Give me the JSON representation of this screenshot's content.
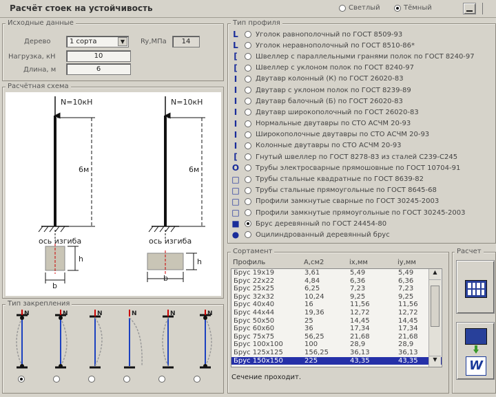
{
  "window": {
    "title": "Расчёт стоек на устойчивость"
  },
  "theme": {
    "options": [
      "Светлый",
      "Тёмный"
    ],
    "selected": "Тёмный"
  },
  "source": {
    "legend": "Исходные данные",
    "wood_label": "Дерево",
    "wood_value": "1 сорта",
    "ru_label": "Ry,МПа",
    "ru_value": "14",
    "load_label": "Нагрузка, кН",
    "load_value": "10",
    "length_label": "Длина, м",
    "length_value": "6"
  },
  "scheme": {
    "legend": "Расчётная схема",
    "force": "N=10кН",
    "length": "6м",
    "axis": "ось изгиба",
    "h": "h",
    "b": "b"
  },
  "fixing": {
    "legend": "Тип закрепления",
    "n": "N",
    "count": 6,
    "selected_index": 0
  },
  "profiles": {
    "legend": "Тип профиля",
    "selected_index": 18,
    "items": [
      {
        "icon": "L",
        "label": "Уголок равнополочный по ГОСТ 8509-93"
      },
      {
        "icon": "L",
        "label": "Уголок неравнополочный по ГОСТ 8510-86*"
      },
      {
        "icon": "[",
        "label": "Швеллер с параллельными гранями полок по ГОСТ 8240-97"
      },
      {
        "icon": "[",
        "label": "Швеллер с уклоном полок по ГОСТ 8240-97"
      },
      {
        "icon": "I",
        "label": "Двутавр колонный (К) по ГОСТ 26020-83"
      },
      {
        "icon": "I",
        "label": "Двутавр с уклоном полок по ГОСТ 8239-89"
      },
      {
        "icon": "I",
        "label": "Двутавр балочный (Б) по ГОСТ 26020-83"
      },
      {
        "icon": "I",
        "label": "Двутавр широкополочный по ГОСТ 26020-83"
      },
      {
        "icon": "I",
        "label": "Нормальные двутавры по СТО АСЧМ 20-93"
      },
      {
        "icon": "I",
        "label": "Широкополочные двутавры по СТО АСЧМ 20-93"
      },
      {
        "icon": "I",
        "label": "Колонные двутавры по СТО АСЧМ 20-93"
      },
      {
        "icon": "[",
        "label": "Гнутый швеллер по ГОСТ 8278-83 из сталей С239-С245"
      },
      {
        "icon": "O",
        "label": "Трубы электросварные прямошовные по ГОСТ 10704-91"
      },
      {
        "icon": "□",
        "label": "Трубы стальные квадратные по ГОСТ 8639-82"
      },
      {
        "icon": "□",
        "label": "Трубы стальные прямоугольные по ГОСТ 8645-68"
      },
      {
        "icon": "□",
        "label": "Профили замкнутые сварные по ГОСТ 30245-2003"
      },
      {
        "icon": "□",
        "label": "Профили замкнутые прямоугольные по ГОСТ 30245-2003"
      },
      {
        "icon": "■",
        "label": "Брус деревянный по ГОСТ 24454-80"
      },
      {
        "icon": "●",
        "label": "Оцилиндрованный деревянный брус"
      }
    ]
  },
  "assortment": {
    "legend": "Сортамент",
    "headers": [
      "Профиль",
      "A,см2",
      "ix,мм",
      "iy,мм"
    ],
    "selected_index": 12,
    "rows": [
      [
        "Брус 19x19",
        "3,61",
        "5,49",
        "5,49"
      ],
      [
        "Брус 22x22",
        "4,84",
        "6,36",
        "6,36"
      ],
      [
        "Брус 25x25",
        "6,25",
        "7,23",
        "7,23"
      ],
      [
        "Брус 32x32",
        "10,24",
        "9,25",
        "9,25"
      ],
      [
        "Брус 40x40",
        "16",
        "11,56",
        "11,56"
      ],
      [
        "Брус 44x44",
        "19,36",
        "12,72",
        "12,72"
      ],
      [
        "Брус 50x50",
        "25",
        "14,45",
        "14,45"
      ],
      [
        "Брус 60x60",
        "36",
        "17,34",
        "17,34"
      ],
      [
        "Брус 75x75",
        "56,25",
        "21,68",
        "21,68"
      ],
      [
        "Брус 100x100",
        "100",
        "28,9",
        "28,9"
      ],
      [
        "Брус 125x125",
        "156,25",
        "36,13",
        "36,13"
      ],
      [
        "Брус 150x150",
        "225",
        "43,35",
        "43,35"
      ]
    ],
    "status": "Сечение проходит."
  },
  "calc": {
    "legend": "Расчет",
    "word_badge": "W"
  }
}
